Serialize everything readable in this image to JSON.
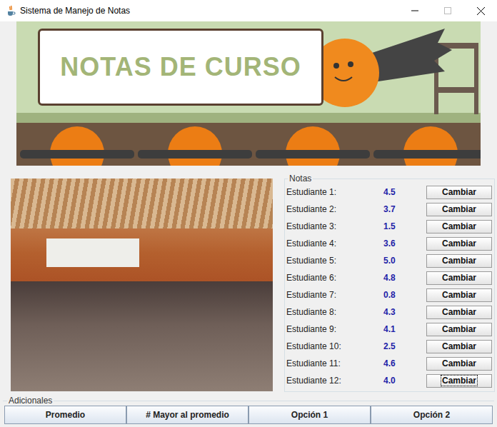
{
  "window": {
    "title": "Sistema de Manejo de Notas"
  },
  "banner": {
    "title": "NOTAS DE CURSO"
  },
  "notas": {
    "title": "Notas",
    "students": [
      {
        "label": "Estudiante 1:",
        "grade": "4.5",
        "button": "Cambiar",
        "focused": false
      },
      {
        "label": "Estudiante 2:",
        "grade": "3.7",
        "button": "Cambiar",
        "focused": false
      },
      {
        "label": "Estudiante 3:",
        "grade": "1.5",
        "button": "Cambiar",
        "focused": false
      },
      {
        "label": "Estudiante 4:",
        "grade": "3.6",
        "button": "Cambiar",
        "focused": false
      },
      {
        "label": "Estudiante 5:",
        "grade": "5.0",
        "button": "Cambiar",
        "focused": false
      },
      {
        "label": "Estudiante 6:",
        "grade": "4.8",
        "button": "Cambiar",
        "focused": false
      },
      {
        "label": "Estudiante 7:",
        "grade": "0.8",
        "button": "Cambiar",
        "focused": false
      },
      {
        "label": "Estudiante 8:",
        "grade": "4.3",
        "button": "Cambiar",
        "focused": false
      },
      {
        "label": "Estudiante 9:",
        "grade": "4.1",
        "button": "Cambiar",
        "focused": false
      },
      {
        "label": "Estudiante 10:",
        "grade": "2.5",
        "button": "Cambiar",
        "focused": false
      },
      {
        "label": "Estudiante 11:",
        "grade": "4.6",
        "button": "Cambiar",
        "focused": false
      },
      {
        "label": "Estudiante 12:",
        "grade": "4.0",
        "button": "Cambiar",
        "focused": true
      }
    ]
  },
  "adicionales": {
    "title": "Adicionales",
    "buttons": [
      "Promedio",
      "# Mayor al promedio",
      "Opción 1",
      "Opción 2"
    ]
  }
}
